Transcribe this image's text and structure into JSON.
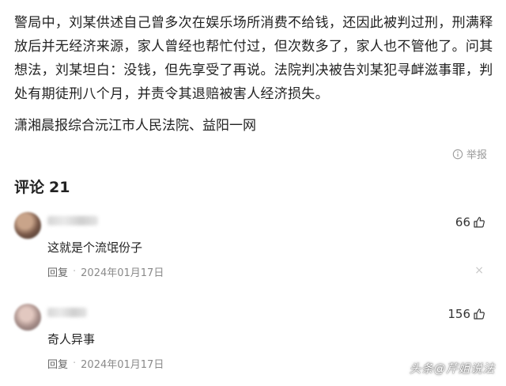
{
  "article": {
    "paragraph": "警局中，刘某供述自己曾多次在娱乐场所消费不给钱，还因此被判过刑，刑满释放后并无经济来源，家人曾经也帮忙付过，但次数多了，家人也不管他了。问其想法，刘某坦白：没钱，但先享受了再说。法院判决被告刘某犯寻衅滋事罪，判处有期徒刑八个月，并责令其退赔被害人经济损失。",
    "source": "潇湘晨报综合沅江市人民法院、益阳一网"
  },
  "report_label": "举报",
  "comments": {
    "title": "评论",
    "count": "21",
    "items": [
      {
        "text": "这就是个流氓份子",
        "likes": "66",
        "reply_label": "回复",
        "separator": "·",
        "date": "2024年01月17日",
        "close_symbol": "×"
      },
      {
        "text": "奇人异事",
        "likes": "156",
        "reply_label": "回复",
        "separator": "·",
        "date": "2024年01月17日"
      }
    ]
  },
  "watermark": "头条@芹姐说法",
  "colors": {
    "text": "#222222",
    "muted": "#8a8a8a",
    "background": "#ffffff"
  },
  "icons": {
    "report": "info-circle-icon",
    "like": "thumbs-up-icon",
    "close": "close-icon"
  }
}
